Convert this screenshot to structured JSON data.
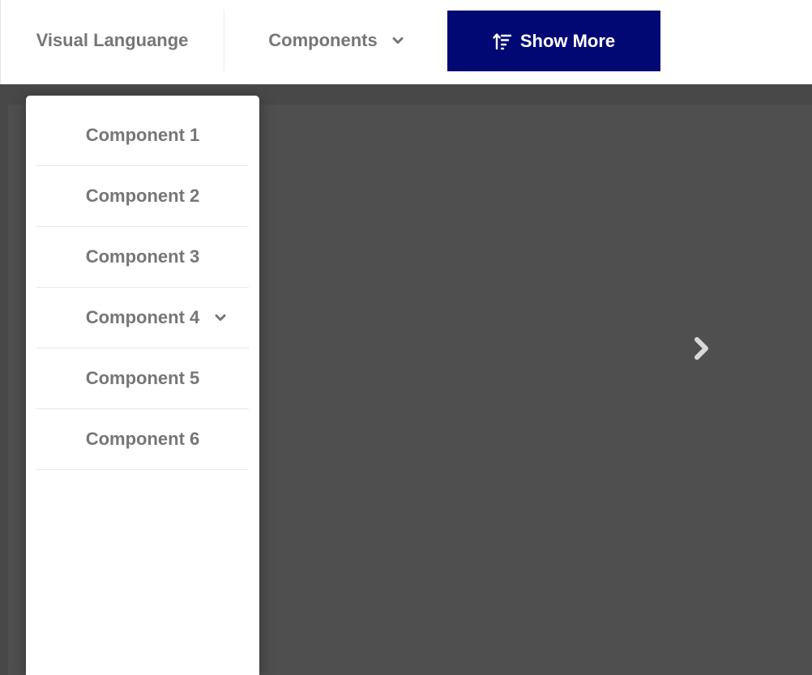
{
  "header": {
    "visual_language_label": "Visual Languange",
    "components_label": "Components",
    "show_more_label": "Show More"
  },
  "dropdown": {
    "items": [
      {
        "label": "Component 1",
        "has_submenu": false
      },
      {
        "label": "Component 2",
        "has_submenu": false
      },
      {
        "label": "Component 3",
        "has_submenu": false
      },
      {
        "label": "Component 4",
        "has_submenu": true
      },
      {
        "label": "Component 5",
        "has_submenu": false
      },
      {
        "label": "Component 6",
        "has_submenu": false
      }
    ]
  },
  "icons": {
    "components_dropdown": "chevron-down-icon",
    "show_more": "sort-ascending-icon",
    "carousel_next": "chevron-right-icon"
  },
  "colors": {
    "accent": "#020873",
    "nav_text": "#767676",
    "overlay": "#484848"
  }
}
